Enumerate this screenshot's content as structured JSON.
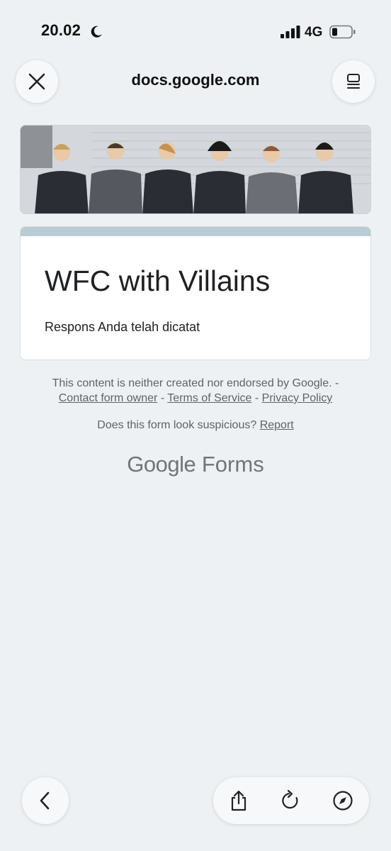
{
  "status_bar": {
    "time": "20.02",
    "network": "4G",
    "icons": [
      "moon-icon",
      "signal-icon",
      "battery-icon"
    ]
  },
  "browser": {
    "url": "docs.google.com",
    "icons": [
      "close-icon",
      "tabs-icon",
      "back-icon",
      "share-icon",
      "reload-icon",
      "compass-icon"
    ]
  },
  "form": {
    "title": "WFC with Villains",
    "response": "Respons Anda telah dicatat",
    "accent_color": "#b9ccd3"
  },
  "footer": {
    "disclaimer": "This content is neither created nor endorsed by Google. -",
    "contact_link": "Contact form owner",
    "terms_link": "Terms of Service",
    "privacy_link": "Privacy Policy",
    "separator": "-",
    "suspicious_text": "Does this form look suspicious?",
    "report_link": "Report",
    "brand_google": "Google",
    "brand_forms": "Forms"
  }
}
